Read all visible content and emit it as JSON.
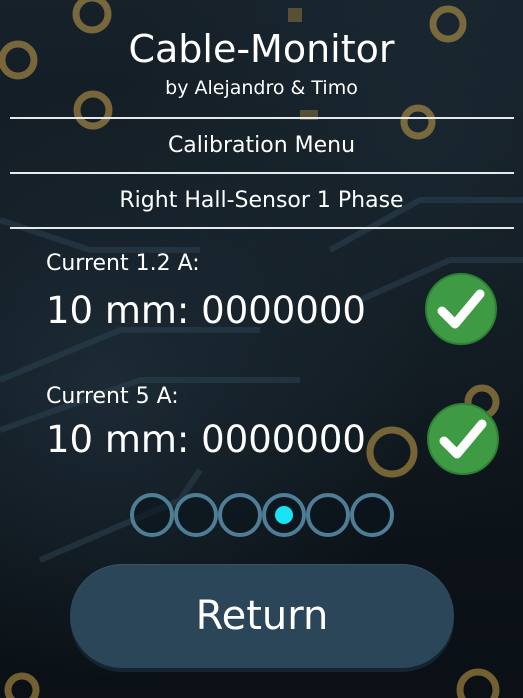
{
  "header": {
    "title": "Cable-Monitor",
    "subtitle": "by Alejandro & Timo"
  },
  "menu": {
    "title": "Calibration Menu",
    "sensor": "Right Hall-Sensor 1 Phase"
  },
  "measurements": [
    {
      "label": "Current 1.2 A:",
      "reading": "10 mm: 0000000",
      "status_icon": "check-icon"
    },
    {
      "label": "Current 5 A:",
      "reading": "10 mm: 0000000",
      "status_icon": "check-icon"
    }
  ],
  "pagination": {
    "pages": 6,
    "current": 4
  },
  "return_button": {
    "label": "Return"
  },
  "colors": {
    "check_green": "#3e9b44",
    "dot_active": "#18e3f5",
    "dot_border": "#4f7d96",
    "button_bg": "#2a4658"
  }
}
